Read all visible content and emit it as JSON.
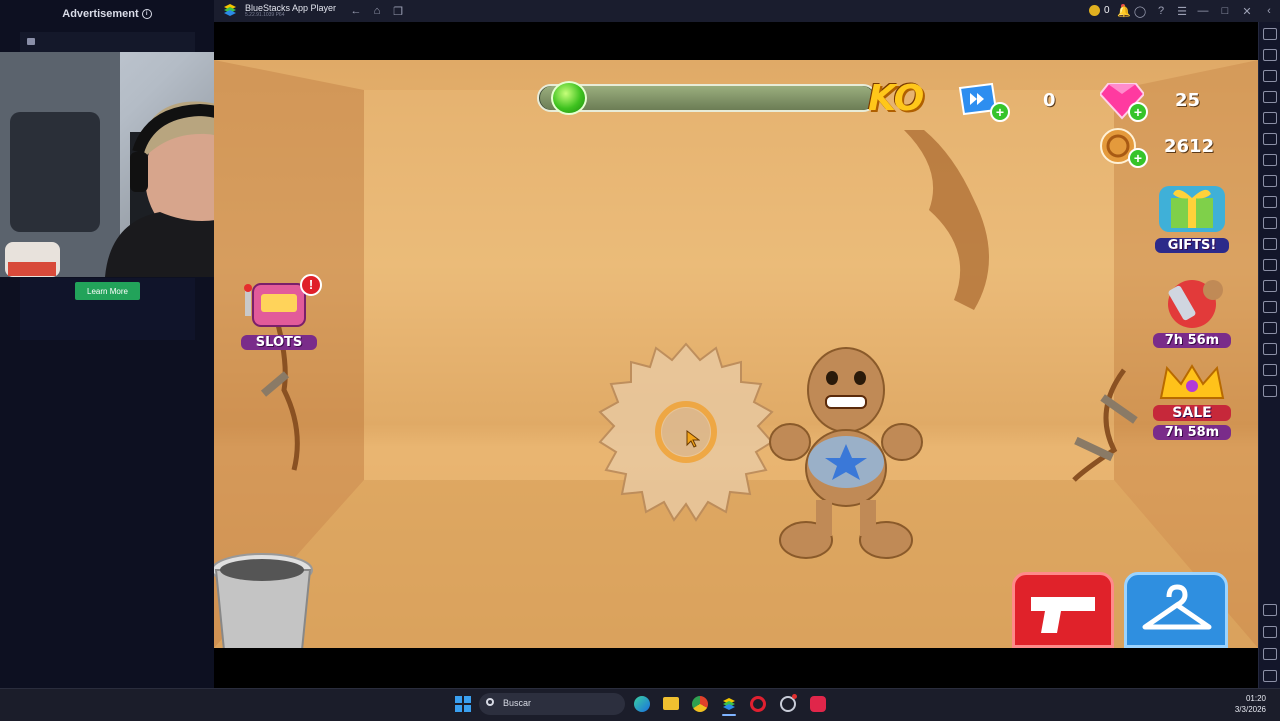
{
  "ad": {
    "title": "Advertisement",
    "info_icon": "info-icon",
    "learn_more": "Learn More"
  },
  "titlebar": {
    "app_title": "BlueStacks App Player",
    "version": "5.22.91.1039 P64",
    "coins": "0"
  },
  "hud": {
    "ko_label": "KO",
    "ko_progress": 0.05,
    "skips": "0",
    "gems": "25",
    "bucks": "2612"
  },
  "promos": {
    "slots": "SLOTS",
    "gifts": "GIFTS!",
    "chainsaw_timer": "7h 56m",
    "sale": "SALE",
    "sale_timer": "7h 58m"
  },
  "taskbar": {
    "search_placeholder": "Buscar",
    "time": "01:20",
    "date": "3/3/2026"
  },
  "colors": {
    "accent_green": "#36c42a",
    "ko_yellow": "#ffc71a",
    "gem_pink": "#ff3aa0",
    "learn_more_green": "#22a35a"
  }
}
